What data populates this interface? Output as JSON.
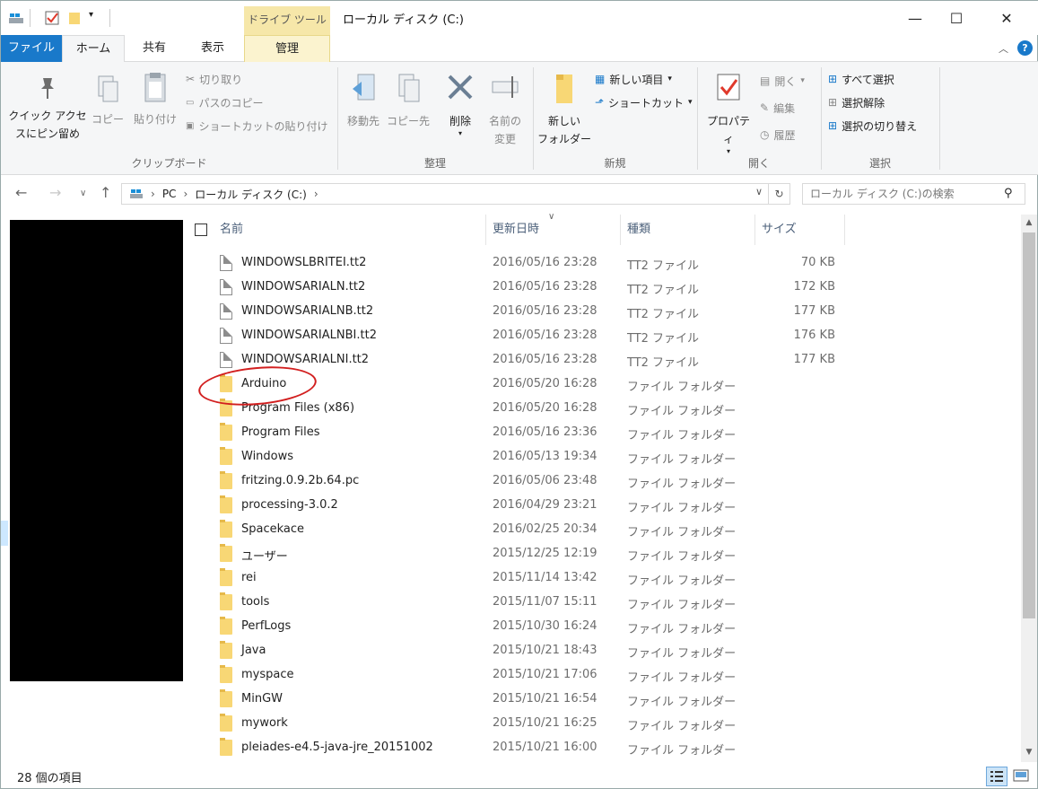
{
  "titlebar": {
    "title": "ローカル ディスク (C:)",
    "context_tab": "ドライブ ツール",
    "minimize": "—",
    "maximize": "☐",
    "close": "✕"
  },
  "tabs": {
    "file": "ファイル",
    "home": "ホーム",
    "share": "共有",
    "view": "表示",
    "manage": "管理"
  },
  "ribbon": {
    "clipboard": {
      "label": "クリップボード",
      "pin_line1": "クイック アクセ",
      "pin_line2": "スにピン留め",
      "copy": "コピー",
      "paste": "貼り付け",
      "cut": "切り取り",
      "copy_path": "パスのコピー",
      "paste_shortcut": "ショートカットの貼り付け"
    },
    "organize": {
      "label": "整理",
      "move_to": "移動先",
      "copy_to": "コピー先",
      "delete": "削除",
      "rename_line1": "名前の",
      "rename_line2": "変更"
    },
    "new": {
      "label": "新規",
      "new_folder_line1": "新しい",
      "new_folder_line2": "フォルダー",
      "new_item": "新しい項目",
      "shortcut": "ショートカット"
    },
    "open": {
      "label": "開く",
      "properties": "プロパティ",
      "open": "開く",
      "edit": "編集",
      "history": "履歴"
    },
    "select": {
      "label": "選択",
      "select_all": "すべて選択",
      "select_none": "選択解除",
      "invert": "選択の切り替え"
    }
  },
  "nav": {
    "breadcrumb": [
      "PC",
      "ローカル ディスク (C:)"
    ],
    "search_placeholder": "ローカル ディスク (C:)の検索"
  },
  "columns": {
    "name": "名前",
    "date": "更新日時",
    "type": "種類",
    "size": "サイズ"
  },
  "files": [
    {
      "name": "WINDOWSLBRITEI.tt2",
      "date": "2016/05/16 23:28",
      "type": "TT2 ファイル",
      "size": "70 KB",
      "kind": "file"
    },
    {
      "name": "WINDOWSARIALN.tt2",
      "date": "2016/05/16 23:28",
      "type": "TT2 ファイル",
      "size": "172 KB",
      "kind": "file"
    },
    {
      "name": "WINDOWSARIALNB.tt2",
      "date": "2016/05/16 23:28",
      "type": "TT2 ファイル",
      "size": "177 KB",
      "kind": "file"
    },
    {
      "name": "WINDOWSARIALNBI.tt2",
      "date": "2016/05/16 23:28",
      "type": "TT2 ファイル",
      "size": "176 KB",
      "kind": "file"
    },
    {
      "name": "WINDOWSARIALNI.tt2",
      "date": "2016/05/16 23:28",
      "type": "TT2 ファイル",
      "size": "177 KB",
      "kind": "file"
    },
    {
      "name": "Arduino",
      "date": "2016/05/20 16:28",
      "type": "ファイル フォルダー",
      "size": "",
      "kind": "folder"
    },
    {
      "name": "Program Files (x86)",
      "date": "2016/05/20 16:28",
      "type": "ファイル フォルダー",
      "size": "",
      "kind": "folder"
    },
    {
      "name": "Program Files",
      "date": "2016/05/16 23:36",
      "type": "ファイル フォルダー",
      "size": "",
      "kind": "folder"
    },
    {
      "name": "Windows",
      "date": "2016/05/13 19:34",
      "type": "ファイル フォルダー",
      "size": "",
      "kind": "folder"
    },
    {
      "name": "fritzing.0.9.2b.64.pc",
      "date": "2016/05/06 23:48",
      "type": "ファイル フォルダー",
      "size": "",
      "kind": "folder"
    },
    {
      "name": "processing-3.0.2",
      "date": "2016/04/29 23:21",
      "type": "ファイル フォルダー",
      "size": "",
      "kind": "folder"
    },
    {
      "name": "Spacekace",
      "date": "2016/02/25 20:34",
      "type": "ファイル フォルダー",
      "size": "",
      "kind": "folder"
    },
    {
      "name": "ユーザー",
      "date": "2015/12/25 12:19",
      "type": "ファイル フォルダー",
      "size": "",
      "kind": "folder"
    },
    {
      "name": "rei",
      "date": "2015/11/14 13:42",
      "type": "ファイル フォルダー",
      "size": "",
      "kind": "folder"
    },
    {
      "name": "tools",
      "date": "2015/11/07 15:11",
      "type": "ファイル フォルダー",
      "size": "",
      "kind": "folder"
    },
    {
      "name": "PerfLogs",
      "date": "2015/10/30 16:24",
      "type": "ファイル フォルダー",
      "size": "",
      "kind": "folder"
    },
    {
      "name": "Java",
      "date": "2015/10/21 18:43",
      "type": "ファイル フォルダー",
      "size": "",
      "kind": "folder"
    },
    {
      "name": "myspace",
      "date": "2015/10/21 17:06",
      "type": "ファイル フォルダー",
      "size": "",
      "kind": "folder"
    },
    {
      "name": "MinGW",
      "date": "2015/10/21 16:54",
      "type": "ファイル フォルダー",
      "size": "",
      "kind": "folder"
    },
    {
      "name": "mywork",
      "date": "2015/10/21 16:25",
      "type": "ファイル フォルダー",
      "size": "",
      "kind": "folder"
    },
    {
      "name": "pleiades-e4.5-java-jre_20151002",
      "date": "2015/10/21 16:00",
      "type": "ファイル フォルダー",
      "size": "",
      "kind": "folder"
    }
  ],
  "status": {
    "count": "28 個の項目"
  },
  "colors": {
    "file_tab": "#1979ca",
    "context_tab": "#f6e7a9",
    "annotation_circle": "#d21f1f"
  }
}
